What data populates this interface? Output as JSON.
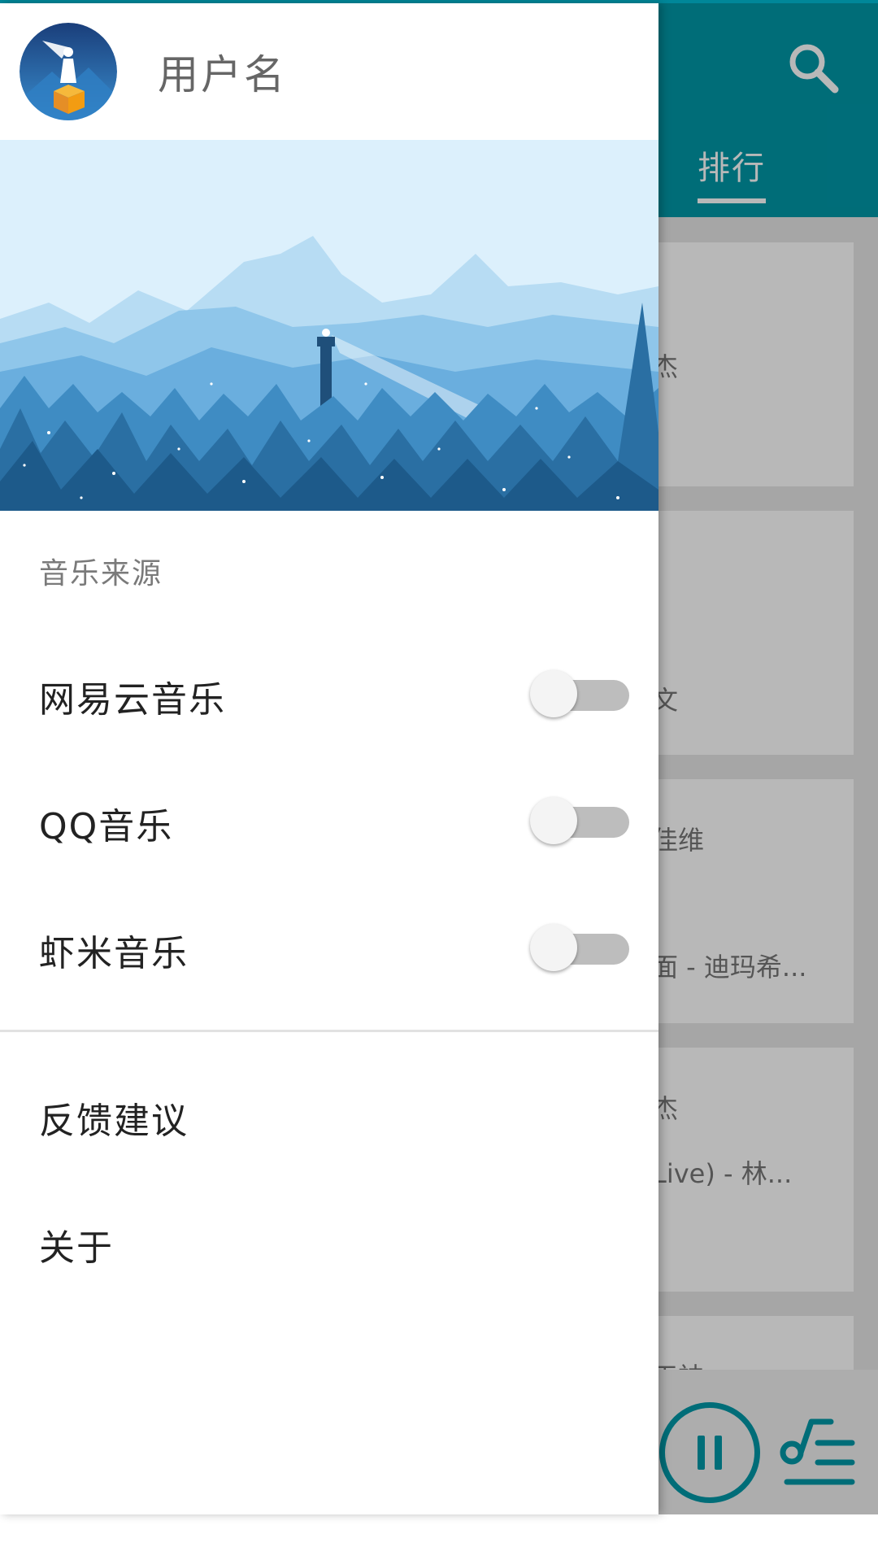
{
  "app": {
    "tab_active": "排行",
    "cards": [
      {
        "line1": "杰",
        "line2": ""
      },
      {
        "line1": "文",
        "line2": ""
      },
      {
        "line1": "佳维",
        "line2": "面 - 迪玛希..."
      },
      {
        "line1": "杰",
        "line2": "Live) - 林..."
      },
      {
        "line1": "天神",
        "line2": ""
      }
    ],
    "accent_color": "#0097a7"
  },
  "drawer": {
    "username": "用户名",
    "section_title": "音乐来源",
    "sources": [
      {
        "label": "网易云音乐",
        "enabled": false
      },
      {
        "label": "QQ音乐",
        "enabled": false
      },
      {
        "label": "虾米音乐",
        "enabled": false
      }
    ],
    "feedback_label": "反馈建议",
    "about_label": "关于"
  },
  "icons": {
    "search": "search-icon",
    "pause": "pause-icon",
    "playlist": "playlist-icon"
  }
}
